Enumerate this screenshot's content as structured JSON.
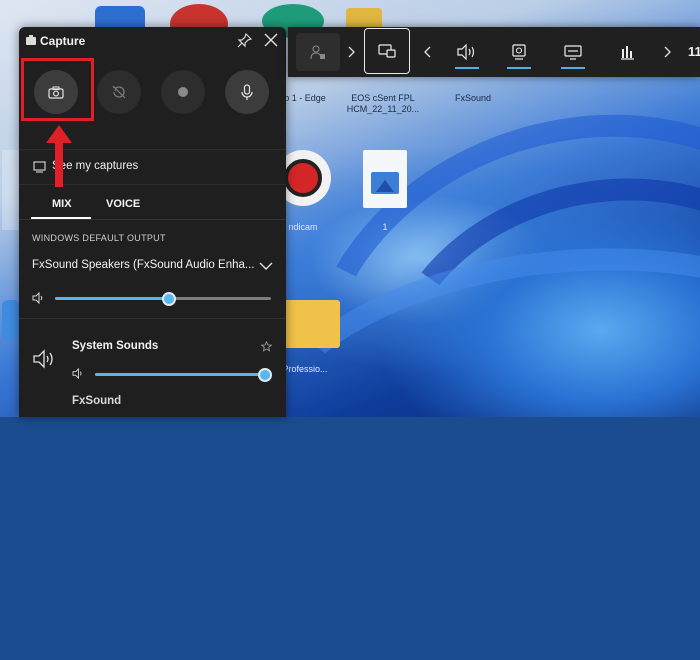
{
  "desktop": {
    "icons": [
      {
        "label": "b 1 - Edge"
      },
      {
        "label": "EOS cSent FPL\nHCM_22_11_20..."
      },
      {
        "label": "FxSound"
      },
      {
        "label": "ndicam"
      },
      {
        "label": "1"
      },
      {
        "label": "Professio..."
      }
    ]
  },
  "capture": {
    "title": "Capture",
    "see_my_captures": "See my captures",
    "tabs": [
      {
        "label": "MIX"
      },
      {
        "label": "VOICE"
      }
    ],
    "output_label": "WINDOWS DEFAULT OUTPUT",
    "device_name": "FxSound Speakers (FxSound Audio Enha...",
    "master_volume": 0.53,
    "apps": [
      {
        "label": "System Sounds",
        "volume": 1.0
      },
      {
        "label": "FxSound"
      }
    ]
  },
  "gamebar": {
    "time": "11"
  },
  "colors": {
    "accent": "#58b4ea",
    "highlight": "#e01f26",
    "panel": "#1f1f20"
  },
  "icons": [
    "capture-widget-icon",
    "pin-icon",
    "close-icon",
    "camera-icon",
    "record-last-icon",
    "record-icon",
    "mic-icon",
    "gallery-icon",
    "speaker-icon",
    "star-icon",
    "chevron-down-icon",
    "xbox-social-icon",
    "chevron-right-icon",
    "chevron-left-icon",
    "widget-capture-icon",
    "audio-icon",
    "performance-icon",
    "resources-icon",
    "stats-icon"
  ]
}
